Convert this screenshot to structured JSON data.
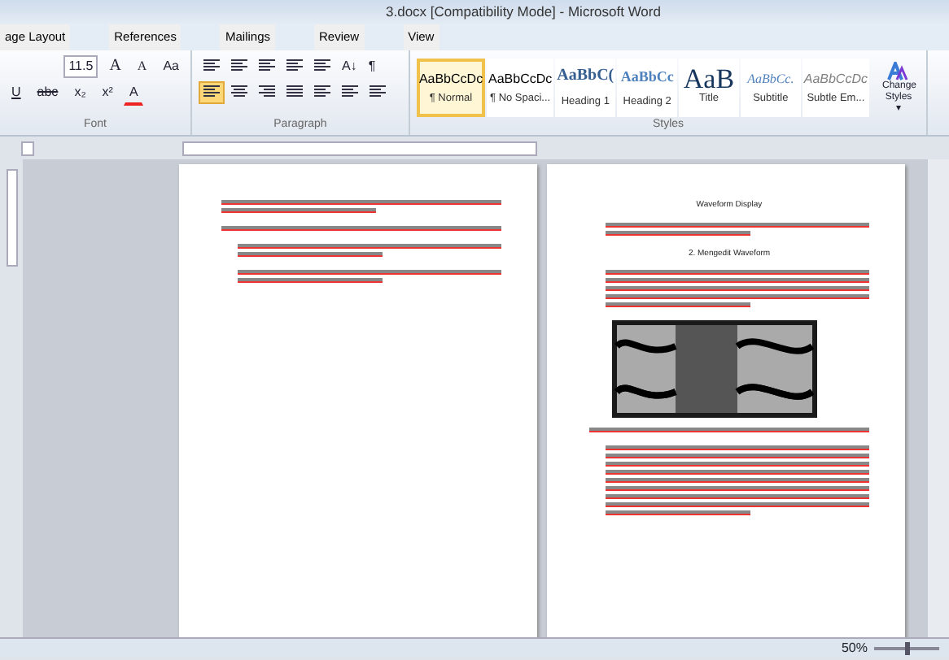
{
  "window": {
    "title": "3.docx [Compatibility Mode] - Microsoft Word"
  },
  "tabs": [
    {
      "label": "age Layout",
      "selected": false
    },
    {
      "label": "References",
      "selected": false
    },
    {
      "label": "Mailings",
      "selected": false
    },
    {
      "label": "Review",
      "selected": false
    },
    {
      "label": "View",
      "selected": false
    }
  ],
  "font_group": {
    "label": "Font",
    "size": "11.5",
    "grow": "A",
    "shrink": "A",
    "case": "Aa",
    "underline": "U",
    "strike": "abc",
    "subscript": "x₂",
    "superscript": "x²",
    "font_color": "A"
  },
  "paragraph_group": {
    "label": "Paragraph",
    "sort": "A↓",
    "pilcrow": "¶",
    "align": [
      {
        "kind": "left",
        "selected": true
      },
      {
        "kind": "center",
        "selected": false
      },
      {
        "kind": "right",
        "selected": false
      },
      {
        "kind": "justify",
        "selected": false
      }
    ]
  },
  "styles": {
    "label": "Styles",
    "items": [
      {
        "preview": "AaBbCcDc",
        "name": "¶ Normal",
        "kind": "normal",
        "selected": true
      },
      {
        "preview": "AaBbCcDc",
        "name": "¶ No Spaci...",
        "kind": "normal",
        "selected": false
      },
      {
        "preview": "AaBbC(",
        "name": "Heading 1",
        "kind": "heading1",
        "selected": false
      },
      {
        "preview": "AaBbCc",
        "name": "Heading 2",
        "kind": "heading2",
        "selected": false
      },
      {
        "preview": "AaB",
        "name": "Title",
        "kind": "title",
        "selected": false
      },
      {
        "preview": "AaBbCc.",
        "name": "Subtitle",
        "kind": "subtitle",
        "selected": false
      },
      {
        "preview": "AaBbCcDc",
        "name": "Subtle Em...",
        "kind": "subtle",
        "selected": false
      }
    ],
    "change_styles": "Change Styles ▾"
  },
  "pages": [
    {
      "blocks": [
        {
          "kind": "lines"
        },
        {
          "kind": "lines"
        },
        {
          "kind": "bullet"
        },
        {
          "kind": "bullet"
        }
      ]
    },
    {
      "blocks": [
        {
          "kind": "heading",
          "text": "Waveform Display"
        },
        {
          "kind": "bullet"
        },
        {
          "kind": "heading",
          "text": "2.  Mengedit Waveform"
        },
        {
          "kind": "lines"
        },
        {
          "kind": "waveform"
        },
        {
          "kind": "lines"
        },
        {
          "kind": "lines"
        }
      ]
    }
  ],
  "status_bar": {
    "zoom": "50%",
    "zoom_slider": {
      "level": 0.5
    }
  }
}
